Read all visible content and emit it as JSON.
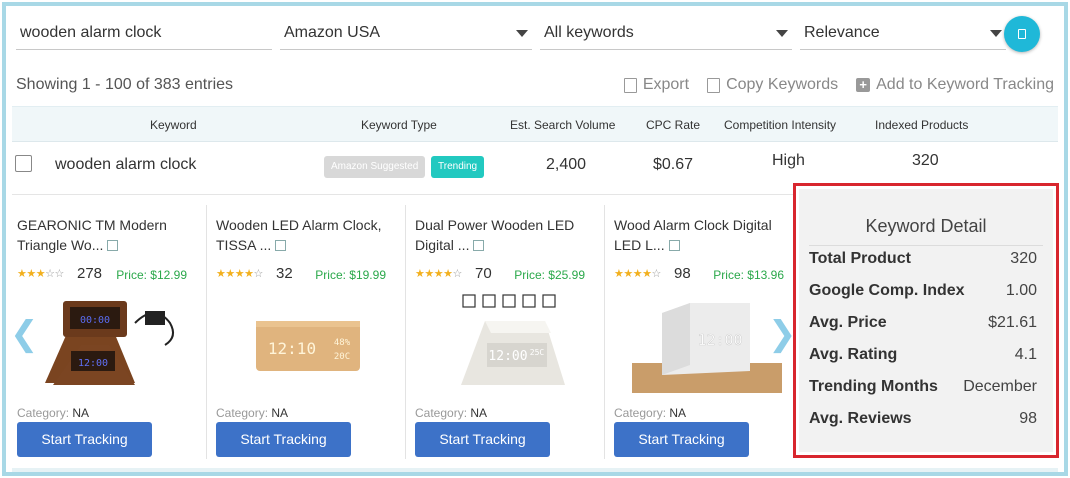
{
  "filters": {
    "search_value": "wooden alarm clock",
    "marketplace": "Amazon USA",
    "keyword_type": "All keywords",
    "sort": "Relevance"
  },
  "info": {
    "entries": "Showing 1 - 100 of 383 entries",
    "export_label": "Export",
    "copy_label": "Copy Keywords",
    "add_label": "Add to Keyword Tracking"
  },
  "table": {
    "headers": [
      "Keyword",
      "Keyword Type",
      "Est. Search Volume",
      "CPC Rate",
      "Competition Intensity",
      "Indexed Products"
    ],
    "row": {
      "keyword": "wooden alarm clock",
      "badges": [
        "Amazon Suggested",
        "Trending"
      ],
      "search_volume": "2,400",
      "cpc": "$0.67",
      "competition": "High",
      "indexed": "320"
    }
  },
  "products": [
    {
      "title": "GEARONIC TM Modern Triangle Wo...",
      "stars": 3,
      "reviews": "278",
      "price": "Price: $12.99",
      "category_label": "Category:",
      "category": "NA",
      "button": "Start Tracking"
    },
    {
      "title": "Wooden LED Alarm Clock, TISSA ...",
      "stars": 4,
      "reviews": "32",
      "price": "Price: $19.99",
      "category_label": "Category:",
      "category": "NA",
      "button": "Start Tracking",
      "img_text1": "12:10",
      "img_text2": "48%",
      "img_text3": "20C"
    },
    {
      "title": "Dual Power Wooden LED Digital ...",
      "stars": 4,
      "reviews": "70",
      "price": "Price: $25.99",
      "category_label": "Category:",
      "category": "NA",
      "button": "Start Tracking",
      "img_text1": "12:00",
      "img_text2": "25C"
    },
    {
      "title": "Wood Alarm Clock Digital LED L...",
      "stars": 4,
      "reviews": "98",
      "price": "Price: $13.96",
      "category_label": "Category:",
      "category": "NA",
      "button": "Start Tracking",
      "img_text1": "12:00"
    }
  ],
  "product0_img": {
    "t1": "00:00",
    "t2": "12:00"
  },
  "detail": {
    "title": "Keyword Detail",
    "rows": [
      {
        "label": "Total Product",
        "value": "320"
      },
      {
        "label": "Google Comp. Index",
        "value": "1.00"
      },
      {
        "label": "Avg. Price",
        "value": "$21.61"
      },
      {
        "label": "Avg. Rating",
        "value": "4.1"
      },
      {
        "label": "Trending Months",
        "value": "December"
      },
      {
        "label": "Avg. Reviews",
        "value": "98"
      }
    ]
  },
  "nav": {
    "prev": "❮",
    "next": "❯"
  },
  "colors": {
    "accent": "#1fb8d8",
    "button": "#3d72c8",
    "price": "#2aa84a",
    "highlight": "#d8262e",
    "trending": "#22c9c0"
  }
}
